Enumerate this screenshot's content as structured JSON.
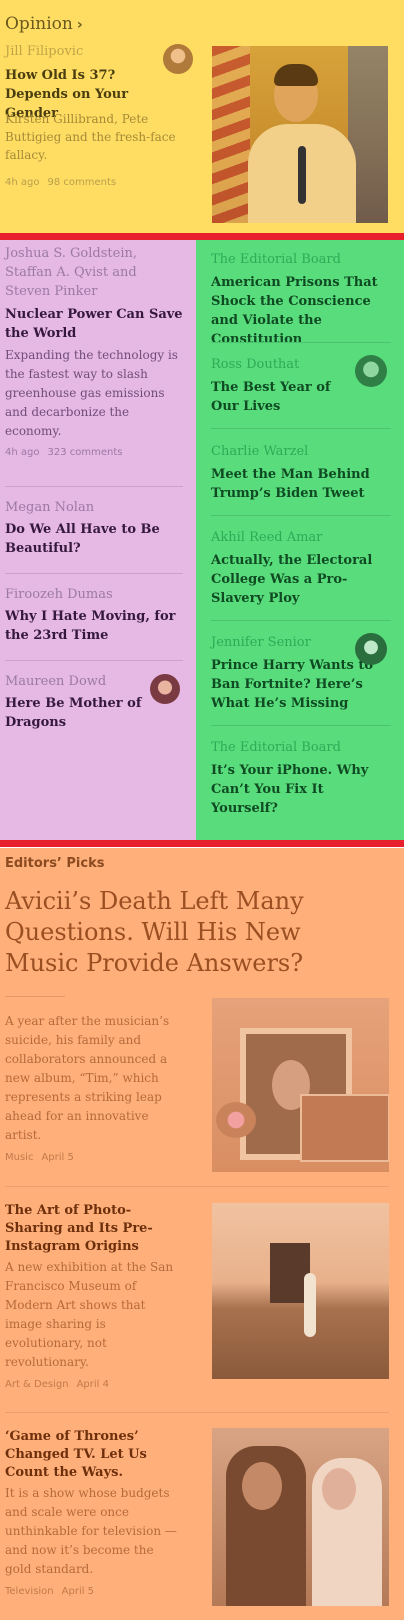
{
  "opinion": {
    "heading": "Opinion",
    "heading_icon": "chevron-right-icon",
    "lead": {
      "author": "Jill Filipovic",
      "title": "How Old Is 37? Depends on Your Gender",
      "summary": "Kirsten Gillibrand, Pete Buttigieg and the fresh-face fallacy.",
      "time": "4h ago",
      "comments": "98 comments"
    },
    "left_column": [
      {
        "author": "Joshua S. Goldstein, Staffan A. Qvist and Steven Pinker",
        "title": "Nuclear Power Can Save the World",
        "summary": "Expanding the technology is the fastest way to slash greenhouse gas emissions and decarbonize the economy.",
        "time": "4h ago",
        "comments": "323 comments"
      },
      {
        "author": "Megan Nolan",
        "title": "Do We All Have to Be Beautiful?"
      },
      {
        "author": "Firoozeh Dumas",
        "title": "Why I Hate Moving, for the 23rd Time"
      },
      {
        "author": "Maureen Dowd",
        "title": "Here Be Mother of Dragons"
      }
    ],
    "right_column": [
      {
        "author": "The Editorial Board",
        "title": "American Prisons That Shock the Conscience and Violate the Constitution"
      },
      {
        "author": "Ross Douthat",
        "title": "The Best Year of Our Lives"
      },
      {
        "author": "Charlie Warzel",
        "title": "Meet the Man Behind Trump’s Biden Tweet"
      },
      {
        "author": "Akhil Reed Amar",
        "title": "Actually, the Electoral College Was a Pro-Slavery Ploy"
      },
      {
        "author": "Jennifer Senior",
        "title": "Prince Harry Wants to Ban Fortnite? Here’s What He’s Missing"
      },
      {
        "author": "The Editorial Board",
        "title": "It’s Your iPhone. Why Can’t You Fix It Yourself?"
      }
    ]
  },
  "editors_picks": {
    "label": "Editors’ Picks",
    "hero": {
      "title": "Avicii’s Death Left Many Questions. Will His New Music Provide Answers?",
      "summary": "A year after the musician’s suicide, his family and collaborators announced a new album, “Tim,” which represents a striking leap ahead for an innovative artist.",
      "section": "Music",
      "date": "April 5"
    },
    "items": [
      {
        "title": "The Art of Photo-Sharing and Its Pre-Instagram Origins",
        "summary": "A new exhibition at the San Francisco Museum of Modern Art shows that image sharing is evolutionary, not revolutionary.",
        "section": "Art & Design",
        "date": "April 4"
      },
      {
        "title": "‘Game of Thrones’ Changed TV. Let Us Count the Ways.",
        "summary": "It is a show whose budgets and scale were once unthinkable for television — and now it’s become the gold standard.",
        "section": "Television",
        "date": "April 5"
      }
    ]
  },
  "colors": {
    "opinion_bg": "#ffdd63",
    "left_col_bg": "#e6b8e4",
    "right_col_bg": "#59dc7c",
    "picks_bg": "#ffb07a",
    "separator": "#e8202e"
  }
}
